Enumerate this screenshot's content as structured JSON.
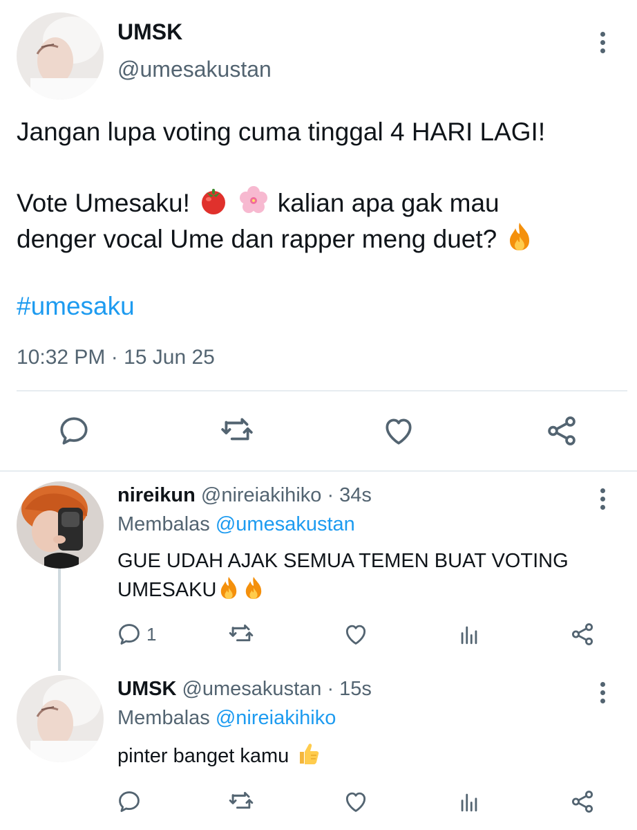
{
  "main_tweet": {
    "author_name": "UMSK",
    "author_handle": "@umesakustan",
    "line1": "Jangan lupa voting cuma tinggal 4 HARI LAGI!",
    "line2_text": "Vote Umesaku!",
    "line2_tail": "kalian apa gak mau",
    "line3": "denger vocal Ume dan rapper meng duet?",
    "hashtag": "#umesaku",
    "timestamp": "10:32 PM · 15 Jun 25",
    "icons": [
      "reply-icon",
      "retweet-icon",
      "like-icon",
      "share-icon"
    ]
  },
  "replies": [
    {
      "author_name": "nireikun",
      "author_handle": "@nireiakihiko",
      "time": "· 34s",
      "replying_label": "Membalas",
      "replying_to": "@umesakustan",
      "line1": "GUE UDAH AJAK SEMUA TEMEN BUAT VOTING",
      "line2": "UMESAKU",
      "reply_count": "1"
    },
    {
      "author_name": "UMSK",
      "author_handle": "@umesakustan",
      "time": "· 15s",
      "replying_label": "Membalas",
      "replying_to": "@nireiakihiko",
      "line1": "pinter banget kamu"
    }
  ],
  "colors": {
    "text": "#0f1419",
    "secondary": "#536471",
    "link": "#1d9bf0",
    "divider": "#e6ecf0"
  }
}
